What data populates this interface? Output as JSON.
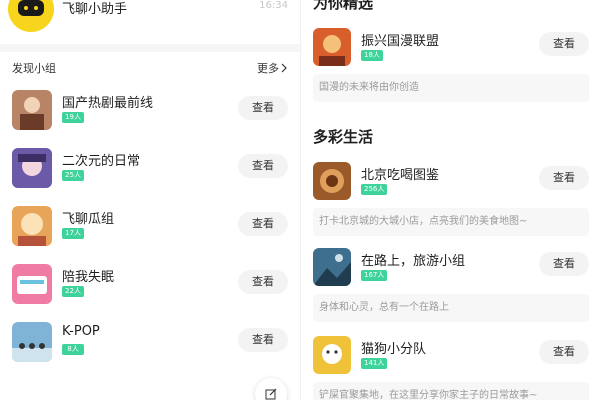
{
  "assistant": {
    "name": "飞聊小助手",
    "time": "16:34"
  },
  "discover": {
    "title": "发现小组",
    "more": "更多",
    "groups": [
      {
        "name": "国产热剧最前线",
        "members": "19人",
        "action": "查看",
        "thumb_color": "#b98466"
      },
      {
        "name": "二次元的日常",
        "members": "25人",
        "action": "查看",
        "thumb_color": "#6a5aa8"
      },
      {
        "name": "飞聊瓜组",
        "members": "17人",
        "action": "查看",
        "thumb_color": "#e8a55a"
      },
      {
        "name": "陪我失眠",
        "members": "22人",
        "action": "查看",
        "thumb_color": "#f07ca6"
      },
      {
        "name": "K-POP",
        "members": "8人",
        "action": "查看",
        "thumb_color": "#7fb4d6"
      }
    ]
  },
  "featured": {
    "title": "为你精选",
    "cards": [
      {
        "name": "振兴国漫联盟",
        "members": "18人",
        "action": "查看",
        "desc": "国漫的未来将由你创造",
        "thumb_color": "#d85e2b"
      }
    ]
  },
  "life": {
    "title": "多彩生活",
    "cards": [
      {
        "name": "北京吃喝图鉴",
        "members": "256人",
        "action": "查看",
        "desc": "打卡北京城的大城小店，点亮我们的美食地图~",
        "thumb_color": "#9b5a2a"
      },
      {
        "name": "在路上，旅游小组",
        "members": "167人",
        "action": "查看",
        "desc": "身体和心灵，总有一个在路上",
        "thumb_color": "#3e6f8f"
      },
      {
        "name": "猫狗小分队",
        "members": "141人",
        "action": "查看",
        "desc": "铲屎官聚集地，在这里分享你家主子的日常故事~",
        "thumb_color": "#f0c23a"
      }
    ]
  },
  "colors": {
    "badge": "#3ed39a",
    "button_bg": "#f3f3f3",
    "desc_bg": "#f7f7f7",
    "assistant_avatar": "#f7d51d"
  }
}
